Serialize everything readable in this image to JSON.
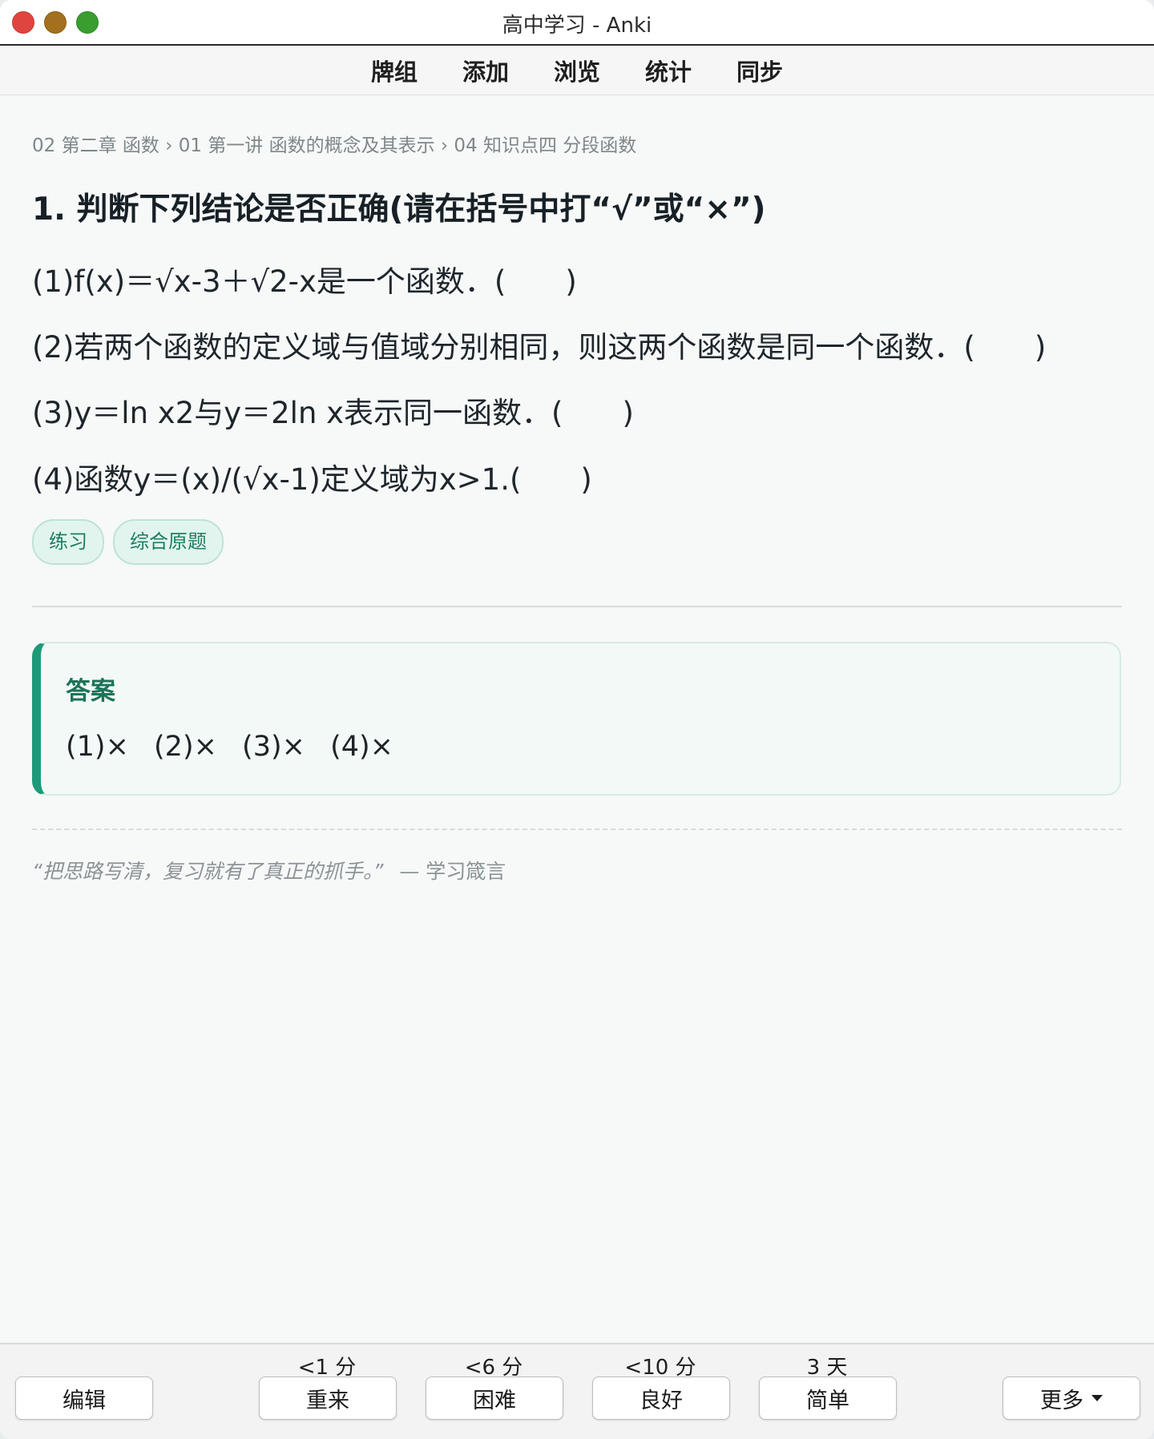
{
  "window": {
    "title": "高中学习 - Anki"
  },
  "topmenu": {
    "items": [
      "牌组",
      "添加",
      "浏览",
      "统计",
      "同步"
    ]
  },
  "card": {
    "breadcrumb": "02 第二章 函数 › 01 第一讲 函数的概念及其表示 › 04 知识点四 分段函数",
    "title": "1.  判断下列结论是否正确(请在括号中打“√”或“×”)",
    "questions": [
      "(1)f(x)＝√x-3＋√2-x是一个函数．(　　)",
      "(2)若两个函数的定义域与值域分别相同，则这两个函数是同一个函数．(　　)",
      "(3)y＝ln x2与y＝2ln x表示同一函数．(　　)",
      "(4)函数y＝(x)/(√x-1)定义域为x>1.(　　)"
    ],
    "tags": [
      "练习",
      "综合原题"
    ],
    "answer": {
      "label": "答案",
      "text": "(1)× (2)× (3)× (4)×"
    },
    "quote": {
      "text": "“把思路写清，复习就有了真正的抓手。”",
      "source": "— 学习箴言"
    }
  },
  "bottombar": {
    "edit_label": "编辑",
    "answers": [
      {
        "interval": "<1 分",
        "label": "重来"
      },
      {
        "interval": "<6 分",
        "label": "困难"
      },
      {
        "interval": "<10 分",
        "label": "良好"
      },
      {
        "interval": "3 天",
        "label": "简单"
      }
    ],
    "more_label": "更多"
  },
  "colors": {
    "accent": "#1e9a78",
    "tag_bg": "#e2f4ee",
    "tag_text": "#1d7f61"
  }
}
